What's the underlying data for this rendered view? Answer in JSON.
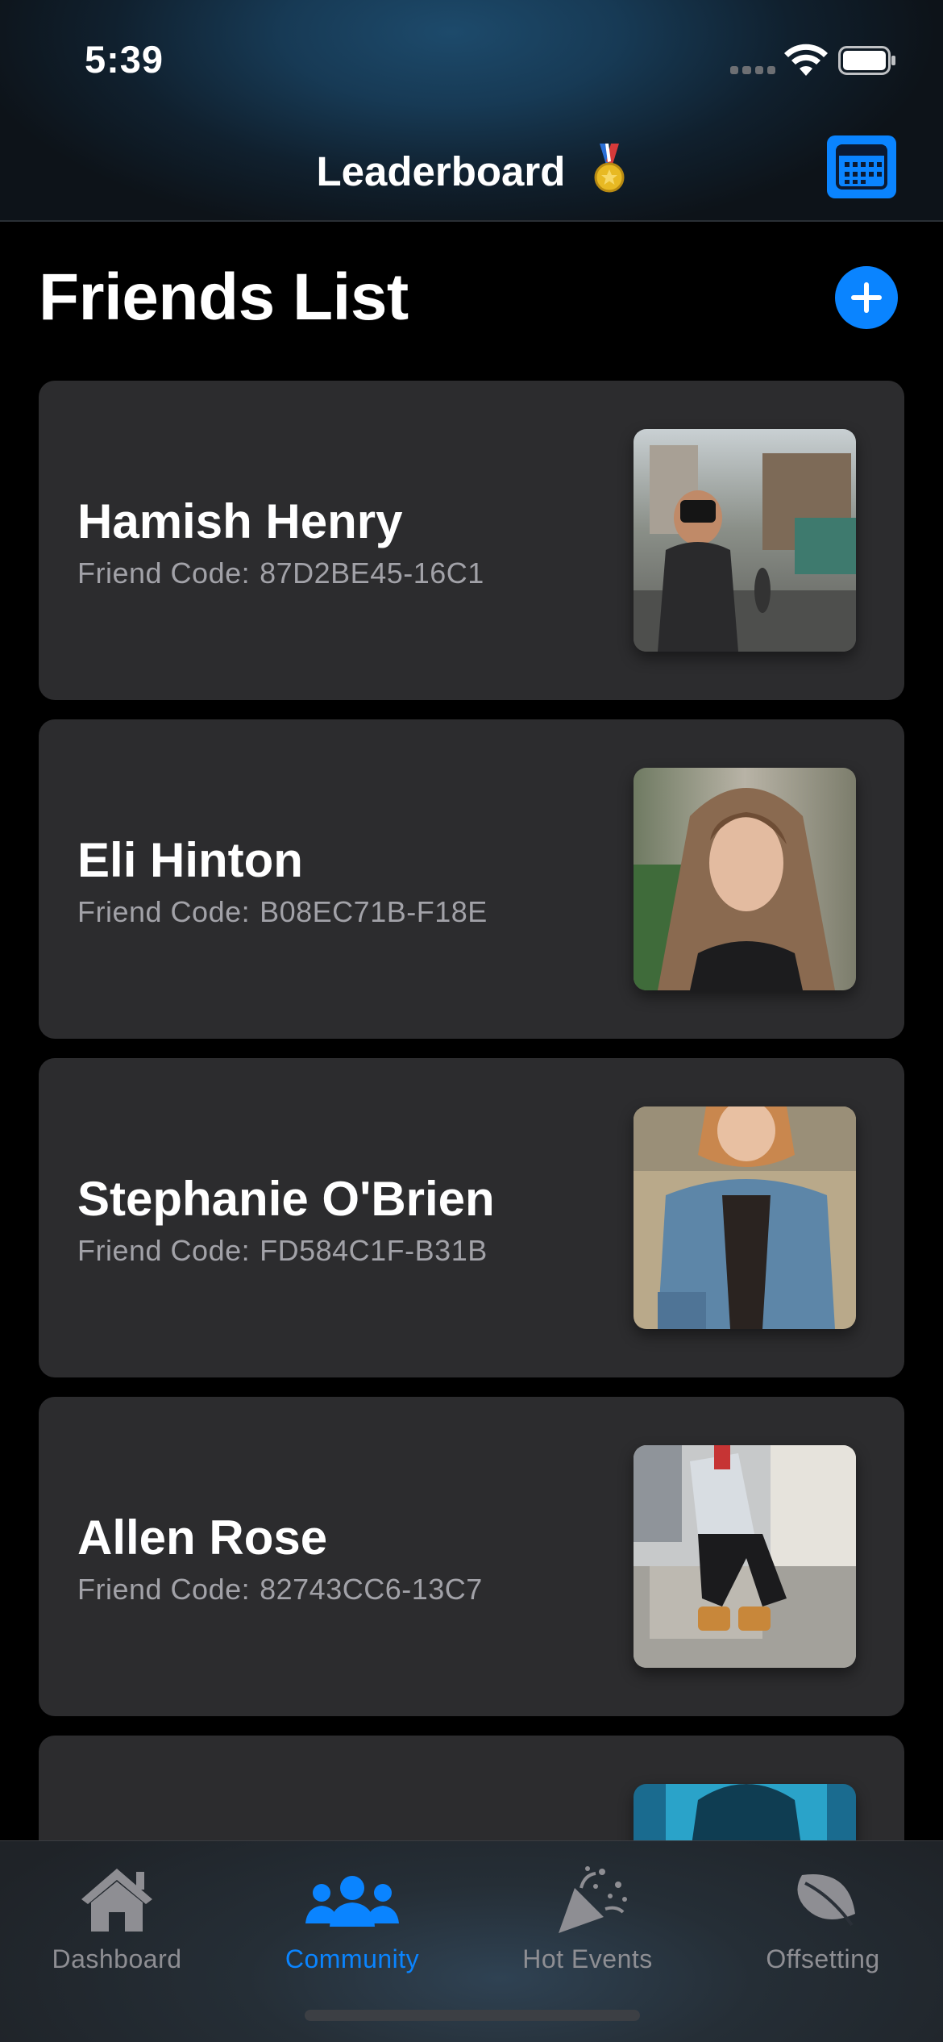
{
  "status_bar": {
    "time": "5:39"
  },
  "nav": {
    "title": "Leaderboard"
  },
  "section": {
    "title": "Friends List"
  },
  "friends": [
    {
      "name": "Hamish Henry",
      "code_label": "Friend Code:",
      "code": "87D2BE45-16C1"
    },
    {
      "name": "Eli Hinton",
      "code_label": "Friend Code:",
      "code": "B08EC71B-F18E"
    },
    {
      "name": "Stephanie O'Brien",
      "code_label": "Friend Code:",
      "code": "FD584C1F-B31B"
    },
    {
      "name": "Allen Rose",
      "code_label": "Friend Code:",
      "code": "82743CC6-13C7"
    }
  ],
  "tabs": [
    {
      "label": "Dashboard",
      "icon": "house-icon",
      "active": false
    },
    {
      "label": "Community",
      "icon": "people-icon",
      "active": true
    },
    {
      "label": "Hot Events",
      "icon": "party-popper-icon",
      "active": false
    },
    {
      "label": "Offsetting",
      "icon": "leaf-icon",
      "active": false
    }
  ],
  "colors": {
    "accent": "#0a84ff",
    "card": "#2c2c2e",
    "background": "#000000",
    "secondary_text": "#a2a2a8"
  }
}
